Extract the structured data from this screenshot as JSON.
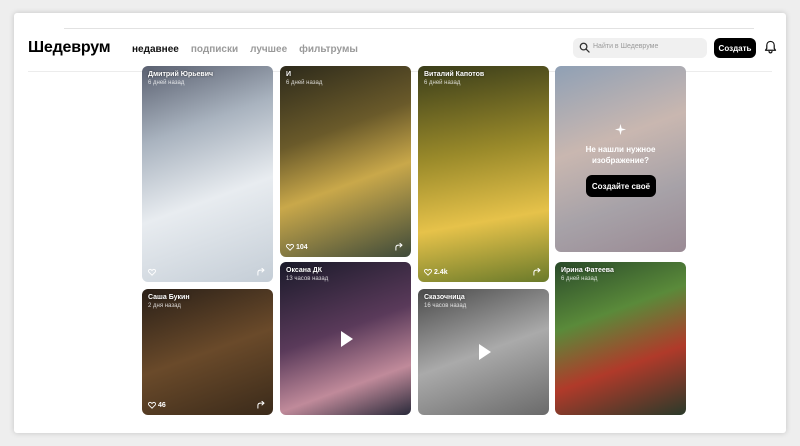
{
  "app": {
    "logo": "Шедеврум"
  },
  "nav": {
    "tabs": [
      {
        "label": "недавнее",
        "active": true
      },
      {
        "label": "подписки",
        "active": false
      },
      {
        "label": "лучшее",
        "active": false
      },
      {
        "label": "фильтрумы",
        "active": false
      }
    ]
  },
  "search": {
    "placeholder": "Найти в Шедевруме"
  },
  "header": {
    "create_label": "Создать"
  },
  "feed": {
    "cards": [
      {
        "author": "Дмитрий Юрьевич",
        "time": "6 дней назад",
        "likes": "",
        "type": "image"
      },
      {
        "author": "И",
        "time": "6 дней назад",
        "likes": "104",
        "type": "image"
      },
      {
        "author": "Виталий Капотов",
        "time": "6 дней назад",
        "likes": "2.4k",
        "type": "image"
      },
      {
        "author": "",
        "time": "",
        "likes": "",
        "type": "prompt"
      },
      {
        "author": "Саша Букин",
        "time": "2 дня назад",
        "likes": "46",
        "type": "image"
      },
      {
        "author": "Оксана ДК",
        "time": "13 часов назад",
        "likes": "",
        "type": "video"
      },
      {
        "author": "Сказочница",
        "time": "16 часов назад",
        "likes": "",
        "type": "video"
      },
      {
        "author": "Ирина Фатеева",
        "time": "6 дней назад",
        "likes": "",
        "type": "image"
      }
    ],
    "prompt_card": {
      "text": "Не нашли нужное изображение?",
      "button": "Создайте своё"
    }
  },
  "colors": {
    "accent": "#000000",
    "muted_text": "#9a9a9a",
    "page_bg": "#ffffff"
  }
}
